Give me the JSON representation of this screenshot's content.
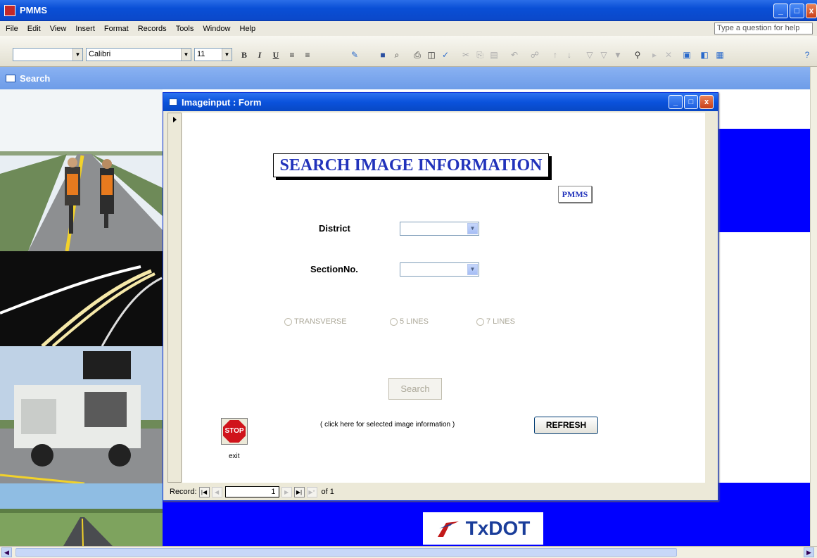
{
  "app": {
    "title": "PMMS"
  },
  "menu": {
    "items": [
      "File",
      "Edit",
      "View",
      "Insert",
      "Format",
      "Records",
      "Tools",
      "Window",
      "Help"
    ],
    "help_placeholder": "Type a question for help"
  },
  "toolbar": {
    "object_combo": "",
    "font": "Calibri",
    "font_size": "11",
    "bold": "B",
    "italic": "I",
    "underline": "U"
  },
  "search_window": {
    "title": "Search"
  },
  "form": {
    "title": "Imageinput : Form",
    "heading": "SEARCH IMAGE INFORMATION",
    "pmms_button": "PMMS",
    "district_label": "District",
    "district_value": "",
    "section_label": "SectionNo.",
    "section_value": "",
    "options": [
      "TRANSVERSE",
      "5 LINES",
      "7 LINES"
    ],
    "search_button": "Search",
    "stop_text": "STOP",
    "exit_label": "exit",
    "hint": "( click here for selected image information )",
    "refresh_button": "REFRESH"
  },
  "navigation": {
    "record_label": "Record:",
    "current": "1",
    "of_label": "of 1"
  },
  "branding": {
    "logo_text": "TxDOT"
  },
  "colors": {
    "accent_blue": "#0000ff",
    "title_blue": "#0a52dc",
    "heading_blue": "#2233bb"
  },
  "icons": [
    "app-icon",
    "minimize-icon",
    "maximize-icon",
    "close-icon",
    "form-icon",
    "record-selector-icon",
    "stop-icon",
    "first-record-icon",
    "prev-record-icon",
    "next-record-icon",
    "last-record-icon",
    "new-record-icon"
  ]
}
